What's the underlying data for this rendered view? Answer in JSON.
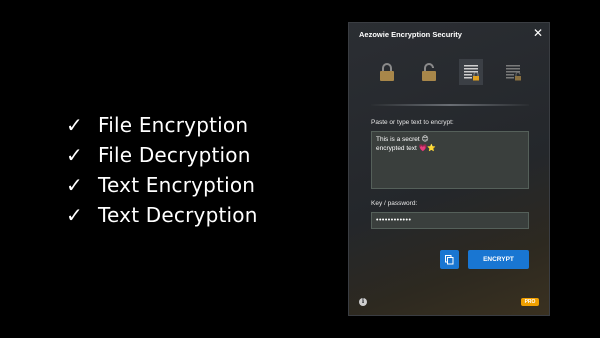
{
  "features": [
    {
      "check": "✓",
      "text": "File Encryption"
    },
    {
      "check": "✓",
      "text": "File Decryption"
    },
    {
      "check": "✓",
      "text": "Text Encryption"
    },
    {
      "check": "✓",
      "text": "Text Decryption"
    }
  ],
  "window": {
    "title": "Aezowie Encryption Security",
    "close_glyph": "✕",
    "modes": [
      {
        "icon": "lock-icon",
        "selected": false
      },
      {
        "icon": "unlock-icon",
        "selected": false
      },
      {
        "icon": "text-lock-icon",
        "selected": true
      },
      {
        "icon": "text-unlock-icon",
        "selected": false
      }
    ],
    "input_label": "Paste or type text to encrypt:",
    "input_line1": "This is a secret",
    "input_line1_emoji": "😊",
    "input_line2": "encrypted text",
    "input_line2_emoji": "💗⭐",
    "password_label": "Key / password:",
    "password_value": "••••••••••••",
    "encrypt_label": "ENCRYPT",
    "info_glyph": "i",
    "pro_badge": "PRO",
    "accent_color": "#1976d2",
    "badge_color": "#f0a000"
  }
}
